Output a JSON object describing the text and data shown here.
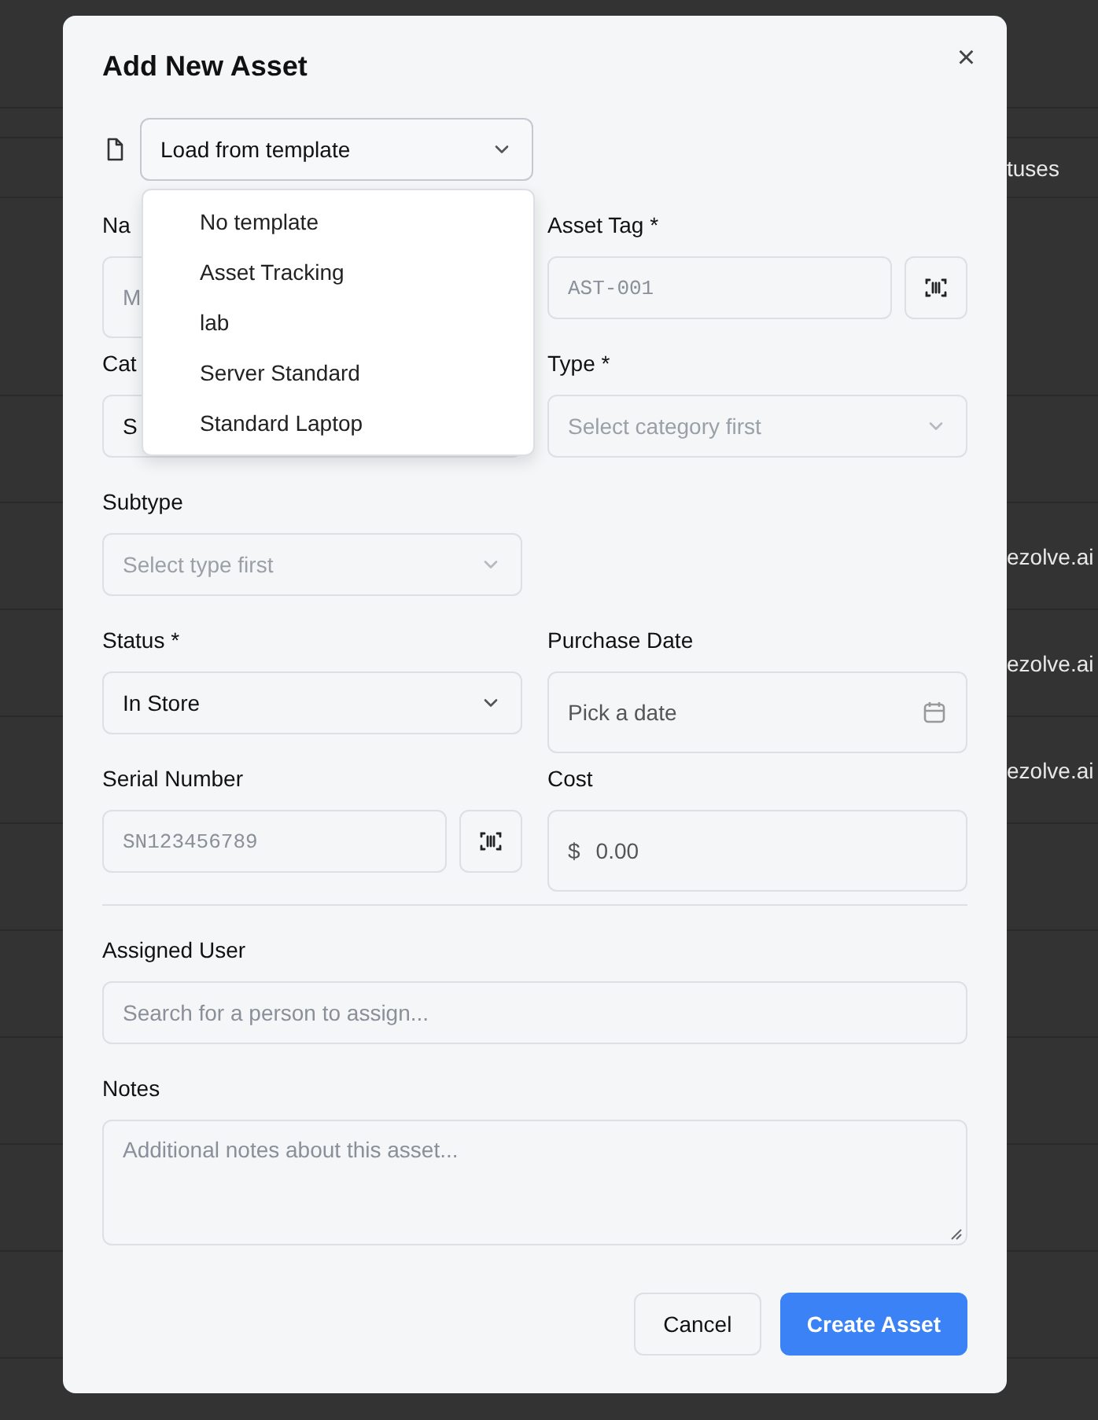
{
  "background": {
    "header_right": "tuses",
    "row_texts": [
      "ezolve.ai",
      "ezolve.ai",
      "ezolve.ai"
    ]
  },
  "dialog": {
    "title": "Add New Asset",
    "close": "×",
    "template_select": {
      "value": "Load from template",
      "expanded": true
    },
    "template_options": [
      "No template",
      "Asset Tracking",
      "lab",
      "Server Standard",
      "Standard Laptop"
    ],
    "fields": [
      {
        "label": "Na",
        "kind": "text",
        "placeholder": "M"
      },
      {
        "label": "Asset Tag *",
        "kind": "scan",
        "placeholder": "AST-001"
      },
      {
        "label": "Cat",
        "kind": "select",
        "value": "S",
        "disabled": false
      },
      {
        "label": "Type *",
        "kind": "select",
        "placeholder": "Select category first",
        "disabled": true
      },
      {
        "label": "Subtype",
        "kind": "select",
        "placeholder": "Select type first",
        "disabled": true
      },
      {
        "kind": "empty"
      },
      {
        "label": "Status *",
        "kind": "select",
        "value": "In Store",
        "disabled": false
      },
      {
        "label": "Purchase Date",
        "kind": "date",
        "placeholder": "Pick a date"
      },
      {
        "label": "Serial Number",
        "kind": "scan",
        "placeholder": "SN123456789"
      },
      {
        "label": "Cost",
        "kind": "money",
        "prefix": "$",
        "placeholder": "0.00"
      }
    ],
    "assigned_user": {
      "label": "Assigned User",
      "placeholder": "Search for a person to assign..."
    },
    "notes": {
      "label": "Notes",
      "placeholder": "Additional notes about this asset..."
    },
    "buttons": [
      {
        "label": "Cancel",
        "kind": "secondary"
      },
      {
        "label": "Create Asset",
        "kind": "primary"
      }
    ]
  }
}
